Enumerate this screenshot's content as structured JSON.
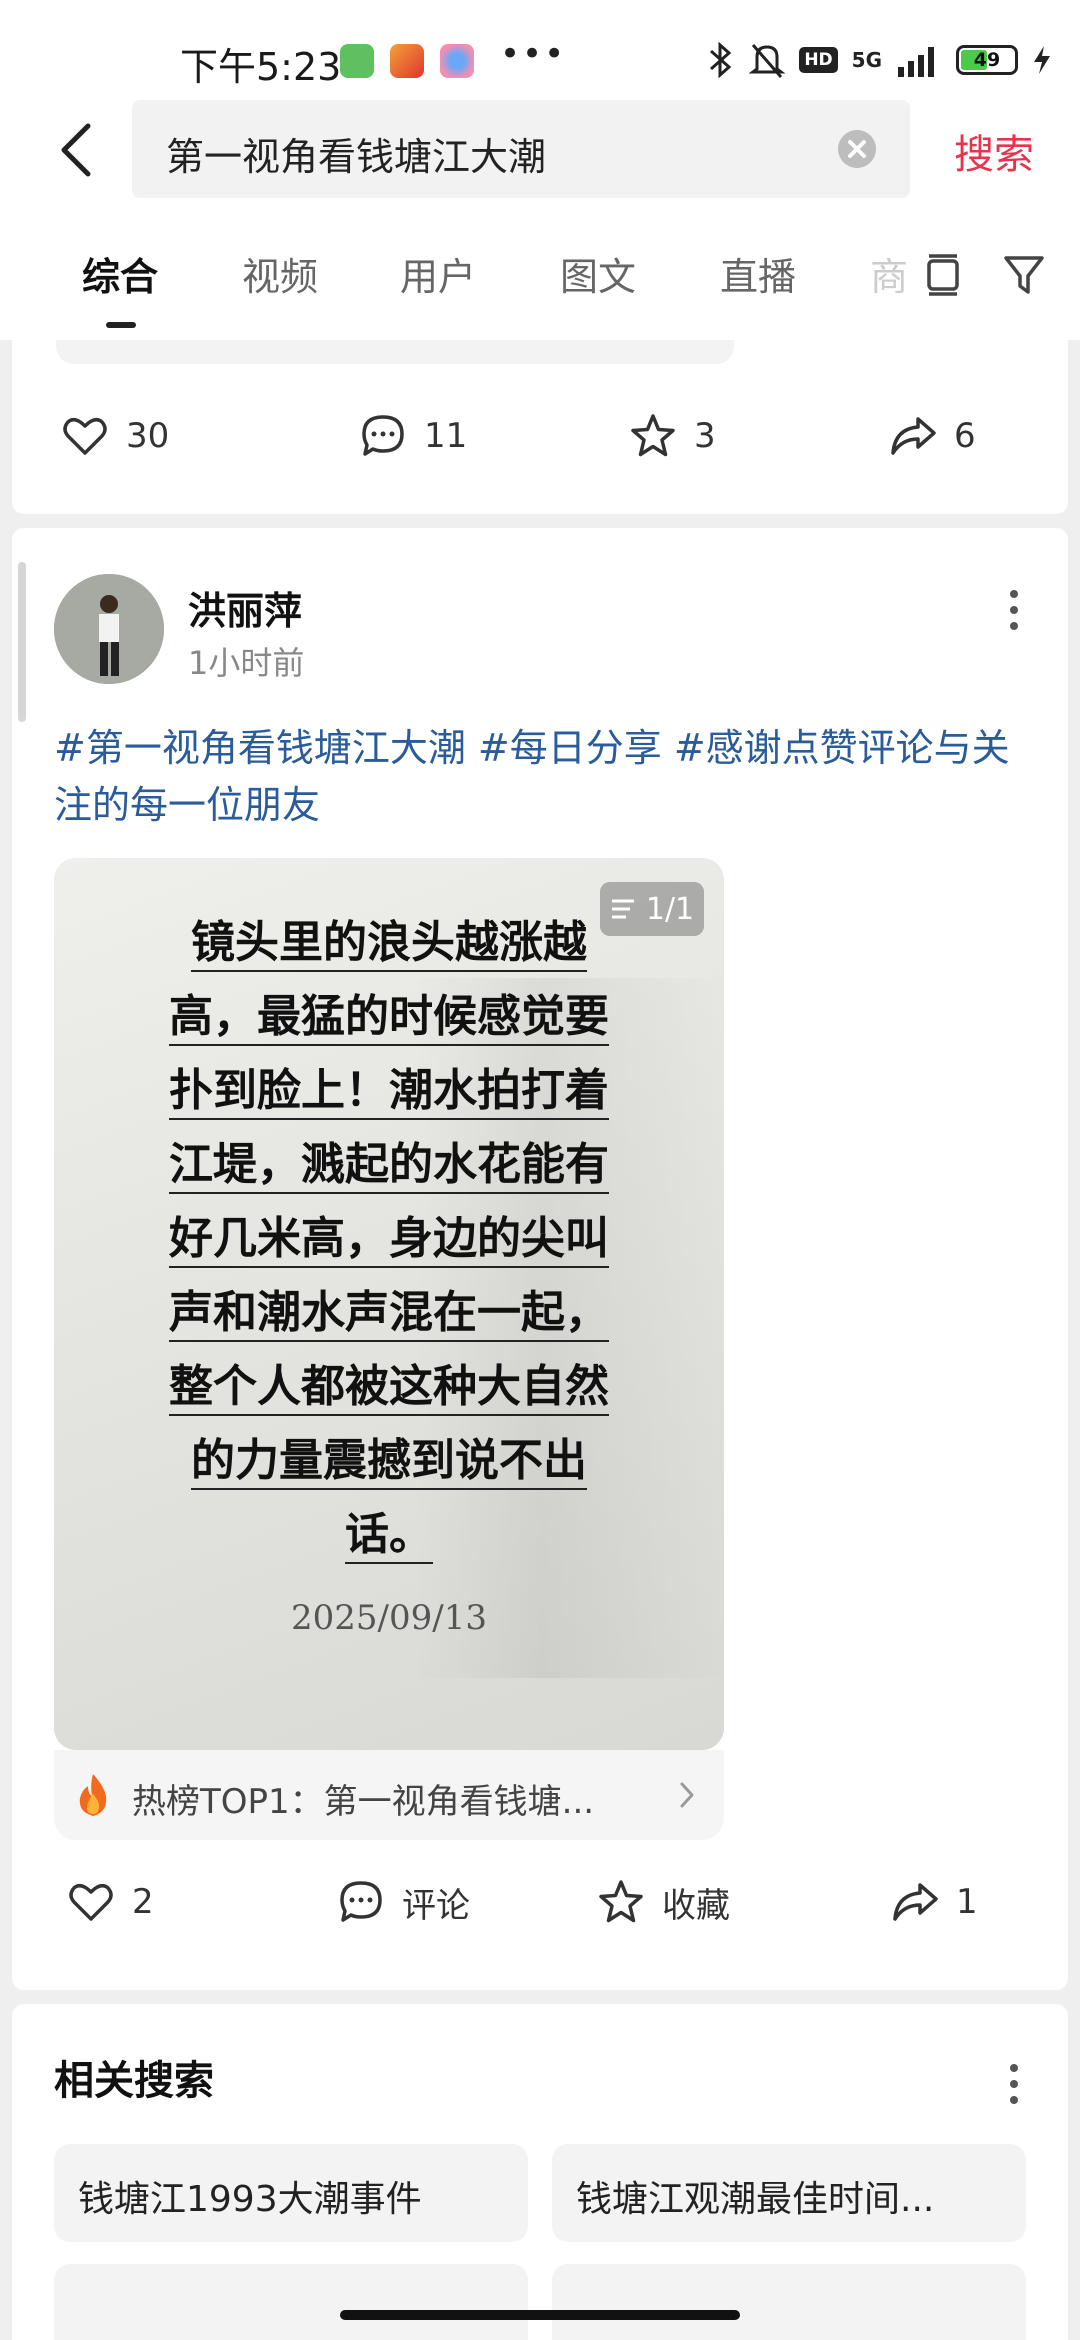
{
  "status_bar": {
    "time": "下午5:23",
    "network": "5G",
    "hd_badge": "HD",
    "battery_level": "49",
    "icons": [
      "app-icon",
      "app-icon",
      "app-icon",
      "bluetooth-icon",
      "mute-icon",
      "signal-icon",
      "battery-icon",
      "charging-icon"
    ]
  },
  "search": {
    "query": "第一视角看钱塘江大潮",
    "submit_label": "搜索"
  },
  "tabs": [
    {
      "label": "综合",
      "active": true
    },
    {
      "label": "视频",
      "active": false
    },
    {
      "label": "用户",
      "active": false
    },
    {
      "label": "图文",
      "active": false
    },
    {
      "label": "直播",
      "active": false
    },
    {
      "label": "商",
      "active": false
    }
  ],
  "previous_post": {
    "likes": "30",
    "comments": "11",
    "favorites": "3",
    "shares": "6"
  },
  "post": {
    "username": "洪丽萍",
    "time": "1小时前",
    "hashtags": "#第一视角看钱塘江大潮 #每日分享 #感谢点赞评论与关注的每一位朋友",
    "image_counter": "1/1",
    "image_text_lines": [
      "镜头里的浪头越涨越",
      "高，最猛的时候感觉要",
      "扑到脸上！潮水拍打着",
      "江堤，溅起的水花能有",
      "好几米高，身边的尖叫",
      "声和潮水声混在一起，",
      "整个人都被这种大自然",
      "的力量震撼到说不出",
      "话。"
    ],
    "image_date": "2025/09/13",
    "hot_rank": "热榜TOP1：第一视角看钱塘...",
    "likes": "2",
    "comment_label": "评论",
    "favorite_label": "收藏",
    "shares": "1"
  },
  "related_searches": {
    "title": "相关搜索",
    "items": [
      "钱塘江1993大潮事件",
      "钱塘江观潮最佳时间..."
    ]
  }
}
